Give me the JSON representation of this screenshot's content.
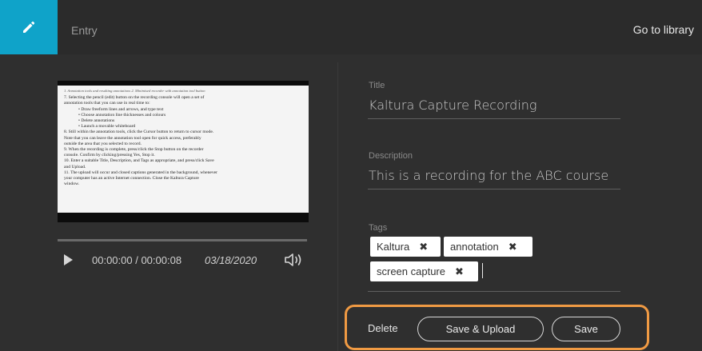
{
  "header": {
    "entry_label": "Entry",
    "library_link": "Go to library",
    "edit_icon": "pencil-icon",
    "accent_color": "#0fa3c9"
  },
  "player": {
    "time_display": "00:00:00 / 00:00:08",
    "date": "03/18/2020",
    "progress_fraction": 0,
    "play_icon": "play-icon",
    "volume_icon": "speaker-icon",
    "doc_caption": "1. Annotation tools and resulting annotations     2. Minimised recorder with annotation tool button",
    "doc_lines": [
      "7.  Selecting the pencil (edit) button on the recording console will open a set of",
      "      annotation tools that you can use in real time to:",
      "•  Draw freeform lines and arrows, and type text",
      "•  Choose annotation line thicknesses and colours",
      "•  Delete annotations",
      "•  Launch a movable whiteboard",
      "8.  Still within the annotation tools, click the Cursor button to return to cursor mode.",
      "      Note that you can leave the annotation tool open for quick access, preferably",
      "      outside the area that you selected to record.",
      "9.  When the recording is complete, press/click the Stop button on the recorder",
      "      console. Confirm by clicking/pressing Yes, Stop it.",
      "10. Enter a suitable Title, Description, and Tags as appropriate, and press/click Save",
      "      and Upload.",
      "11. The upload will occur and closed captions generated in the background, whenever",
      "      your computer has an active Internet connection. Close the Kaltura Capture",
      "      window."
    ]
  },
  "form": {
    "title_label": "Title",
    "title_value": "Kaltura Capture Recording",
    "description_label": "Description",
    "description_value": "This is a recording for the ABC course",
    "tags_label": "Tags",
    "tags": [
      "Kaltura",
      "annotation",
      "screen capture"
    ],
    "tag_remove_glyph": "✖"
  },
  "actions": {
    "delete": "Delete",
    "save_upload": "Save & Upload",
    "save": "Save",
    "highlight_color": "#f09a43"
  }
}
